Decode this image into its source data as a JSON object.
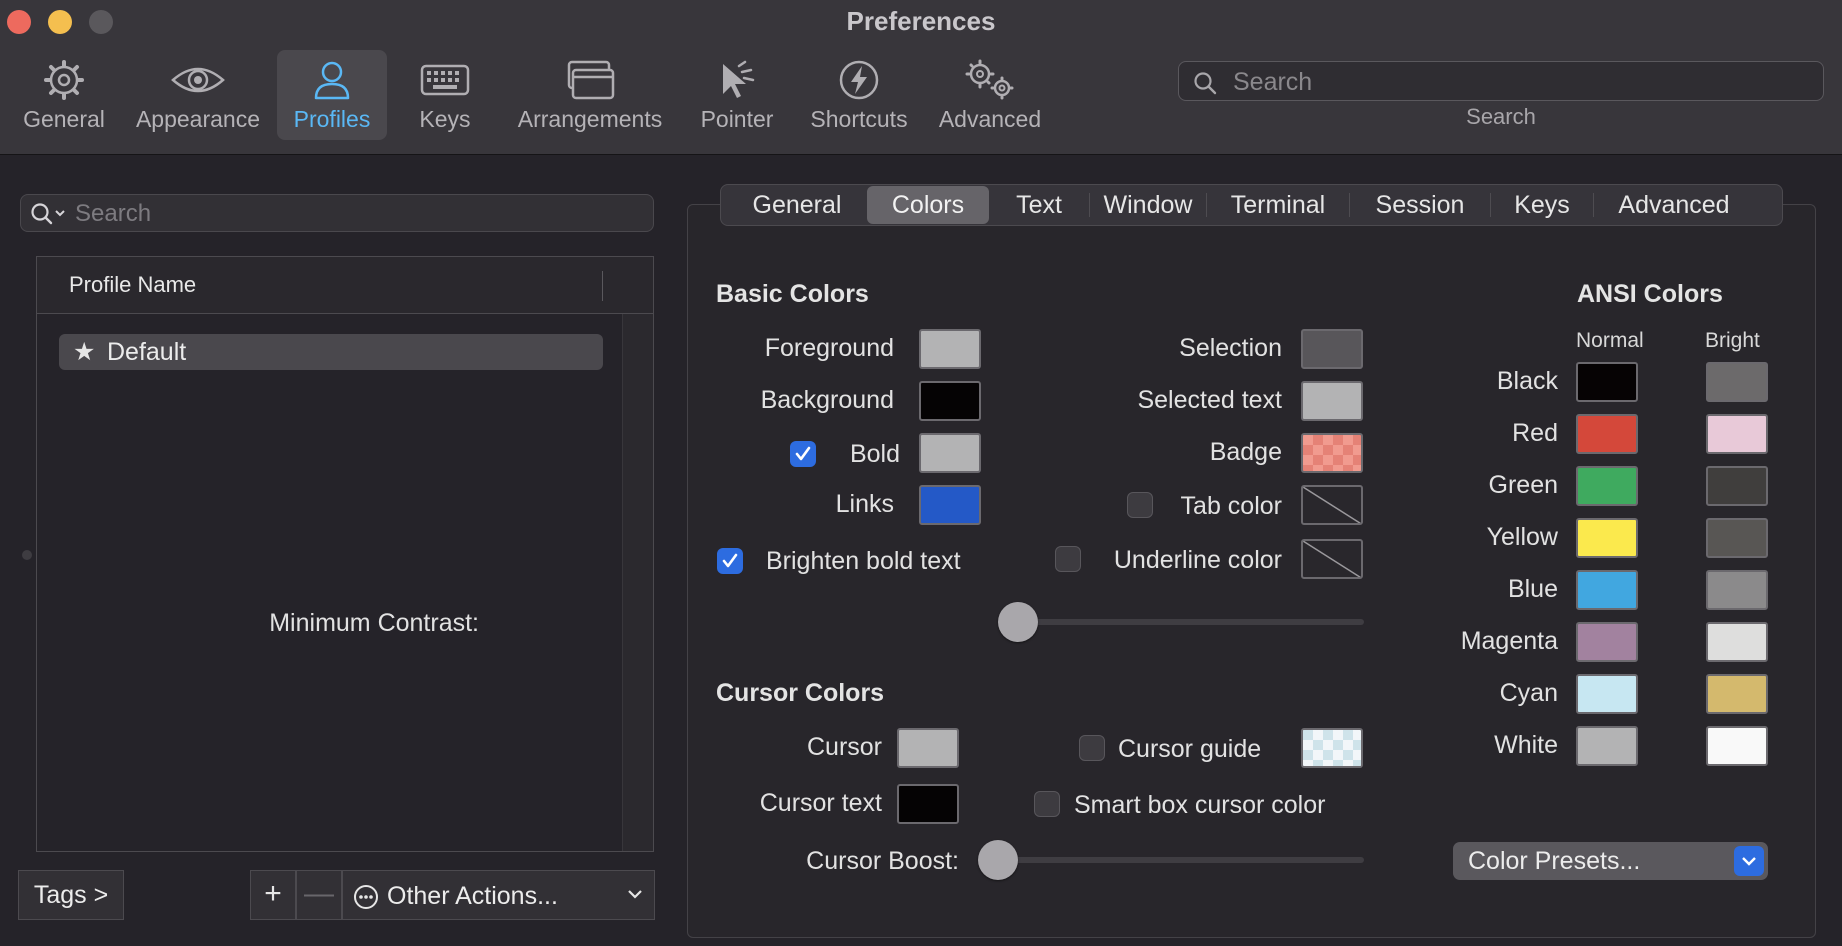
{
  "window": {
    "title": "Preferences"
  },
  "toolbar": {
    "items": [
      {
        "label": "General",
        "icon": "gear-icon"
      },
      {
        "label": "Appearance",
        "icon": "eye-icon"
      },
      {
        "label": "Profiles",
        "icon": "person-icon",
        "active": true
      },
      {
        "label": "Keys",
        "icon": "keyboard-icon"
      },
      {
        "label": "Arrangements",
        "icon": "windows-icon"
      },
      {
        "label": "Pointer",
        "icon": "pointer-icon"
      },
      {
        "label": "Shortcuts",
        "icon": "lightning-icon"
      },
      {
        "label": "Advanced",
        "icon": "gears-icon"
      }
    ],
    "search_placeholder": "Search",
    "search_caption": "Search"
  },
  "profiles": {
    "search_placeholder": "Search",
    "column_header": "Profile Name",
    "rows": [
      {
        "name": "Default",
        "starred": true
      }
    ],
    "tags_button": "Tags >",
    "add_button": "+",
    "remove_button": "—",
    "other_actions": "Other Actions..."
  },
  "tabs": [
    "General",
    "Colors",
    "Text",
    "Window",
    "Terminal",
    "Session",
    "Keys",
    "Advanced"
  ],
  "active_tab": "Colors",
  "basic_colors": {
    "title": "Basic Colors",
    "foreground": {
      "label": "Foreground",
      "color": "#b3b3b4"
    },
    "background": {
      "label": "Background",
      "color": "#050304"
    },
    "bold": {
      "label": "Bold",
      "checked": true,
      "color": "#b3b3b4"
    },
    "links": {
      "label": "Links",
      "color": "#2459c7"
    },
    "brighten_bold": {
      "label": "Brighten bold text",
      "checked": true
    },
    "selection": {
      "label": "Selection",
      "color": "#58565a"
    },
    "selected_text": {
      "label": "Selected text",
      "color": "#b3b3b4"
    },
    "badge": {
      "label": "Badge",
      "color": "#e58276"
    },
    "tab_color": {
      "label": "Tab color",
      "checked": false
    },
    "underline_color": {
      "label": "Underline color",
      "checked": false
    },
    "min_contrast": {
      "label": "Minimum Contrast:",
      "value": 0
    }
  },
  "cursor_colors": {
    "title": "Cursor Colors",
    "cursor": {
      "label": "Cursor",
      "color": "#b3b3b4"
    },
    "cursor_text": {
      "label": "Cursor text",
      "color": "#050304"
    },
    "cursor_guide": {
      "label": "Cursor guide",
      "checked": false,
      "color": "#e7f3f6"
    },
    "smart_box": {
      "label": "Smart box cursor color",
      "checked": false
    },
    "cursor_boost": {
      "label": "Cursor Boost:",
      "value": 0
    }
  },
  "ansi_colors": {
    "title": "ANSI Colors",
    "normal_header": "Normal",
    "bright_header": "Bright",
    "rows": [
      {
        "label": "Black",
        "normal": "#060304",
        "bright": "#6c6a6b"
      },
      {
        "label": "Red",
        "normal": "#d4483a",
        "bright": "#e8c9d8"
      },
      {
        "label": "Green",
        "normal": "#3faa5f",
        "bright": "#403e3d"
      },
      {
        "label": "Yellow",
        "normal": "#fbe94d",
        "bright": "#585654"
      },
      {
        "label": "Blue",
        "normal": "#41a7e0",
        "bright": "#8b8a8b"
      },
      {
        "label": "Magenta",
        "normal": "#a2829f",
        "bright": "#dededd"
      },
      {
        "label": "Cyan",
        "normal": "#c7e7f2",
        "bright": "#d4b96d"
      },
      {
        "label": "White",
        "normal": "#b3b3b4",
        "bright": "#f9f9f9"
      }
    ]
  },
  "color_presets": {
    "label": "Color Presets..."
  }
}
